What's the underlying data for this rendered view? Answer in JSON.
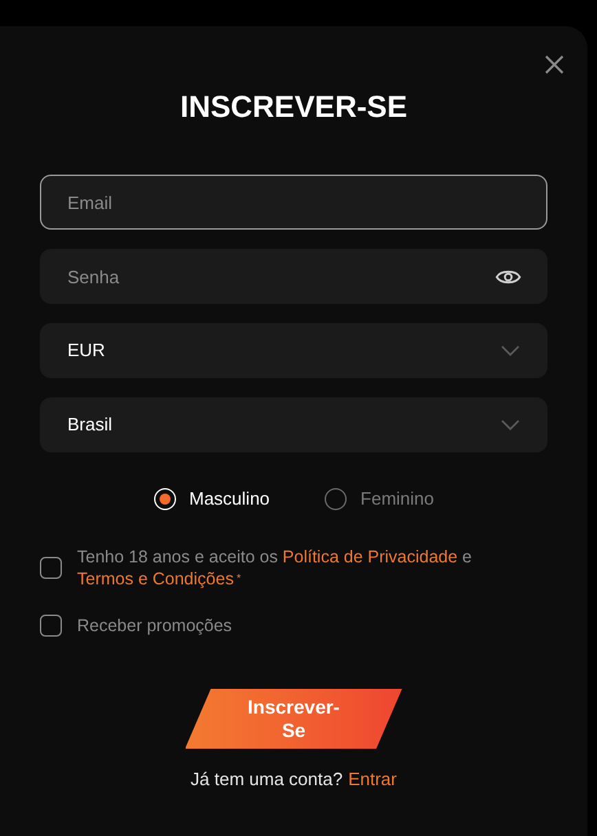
{
  "dialog": {
    "title": "INSCREVER-SE"
  },
  "fields": [
    {
      "kind": "text",
      "placeholder": "Email",
      "focused": true
    },
    {
      "kind": "password",
      "placeholder": "Senha",
      "focused": false
    },
    {
      "kind": "select",
      "value": "EUR",
      "focused": false
    },
    {
      "kind": "select",
      "value": "Brasil",
      "focused": false
    }
  ],
  "gender": [
    {
      "label": "Masculino",
      "selected": true
    },
    {
      "label": "Feminino",
      "selected": false
    }
  ],
  "checkboxes": [
    {
      "checked": false,
      "parts": [
        {
          "kind": "text",
          "text": "Tenho 18 anos e aceito os "
        },
        {
          "kind": "link",
          "text": "Política de Privacidade"
        },
        {
          "kind": "text",
          "text": " e "
        },
        {
          "kind": "link",
          "text": "Termos e Condições"
        },
        {
          "kind": "required",
          "text": "*"
        }
      ]
    },
    {
      "checked": false,
      "parts": [
        {
          "kind": "text",
          "text": "Receber promoções"
        }
      ]
    }
  ],
  "submit": {
    "label": "Inscrever-Se"
  },
  "footer": {
    "text": "Já tem uma conta?",
    "link": "Entrar"
  }
}
